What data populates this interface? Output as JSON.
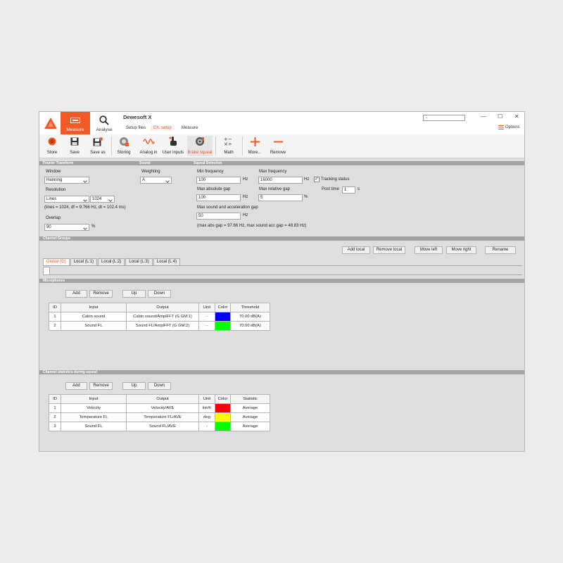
{
  "app": {
    "title": "Dewesoft X",
    "nav": [
      {
        "label": "Measure"
      },
      {
        "label": "Analyse"
      }
    ],
    "subtabs": [
      {
        "label": "Setup files"
      },
      {
        "label": "Ch. setup"
      },
      {
        "label": "Measure"
      }
    ],
    "window_select": {
      "value": "-"
    },
    "window_controls": {
      "minimize": "—",
      "maximize": "☐",
      "close": "✕"
    },
    "options_label": "Options"
  },
  "toolbar": {
    "items": [
      {
        "label": "Store",
        "icon": "record-icon"
      },
      {
        "label": "Save",
        "icon": "floppy-icon"
      },
      {
        "label": "Save as",
        "icon": "floppy-as-icon"
      },
      {
        "label": "Storing",
        "icon": "storing-icon"
      },
      {
        "label": "Analog in",
        "icon": "analog-wave-icon"
      },
      {
        "label": "User inputs",
        "icon": "hand-pointer-icon"
      },
      {
        "label": "Brake squeal",
        "icon": "brake-disc-icon"
      },
      {
        "label": "Math",
        "icon": "math-icon"
      },
      {
        "label": "More...",
        "icon": "plus-icon"
      },
      {
        "label": "Remove",
        "icon": "minus-icon"
      }
    ],
    "accent_color": "#f15a24"
  },
  "fourier": {
    "header": "Fourier Transform",
    "window_label": "Window",
    "window_value": "Hanning",
    "resolution_label": "Resolution",
    "resolution_mode": "Lines",
    "resolution_value": "1024",
    "resolution_info": "(lines = 1024, df = 9.766 Hz, dt = 102.4 ms)",
    "overlap_label": "Overlap",
    "overlap_value": "90",
    "overlap_unit": "%"
  },
  "sound": {
    "header": "Sound",
    "weighting_label": "Weighting",
    "weighting_value": "A"
  },
  "squeal": {
    "header": "Squeal Detection",
    "min_freq_label": "Min frequency",
    "min_freq_value": "100",
    "min_freq_unit": "Hz",
    "max_freq_label": "Max frequency",
    "max_freq_value": "16000",
    "max_freq_unit": "Hz",
    "tracking_label": "Tracking status",
    "tracking_checked": "✓",
    "post_time_label": "Post time",
    "post_time_value": "1",
    "post_time_unit": "s",
    "max_abs_gap_label": "Max absolute gap",
    "max_abs_gap_value": "100",
    "max_abs_gap_unit": "Hz",
    "max_rel_gap_label": "Max relative gap",
    "max_rel_gap_value": "5",
    "max_rel_gap_unit": "%",
    "max_sound_acc_label": "Max sound and acceleration gap",
    "max_sound_acc_value": "50",
    "max_sound_acc_unit": "Hz",
    "info": "(max abs gap = 97.66 Hz, max sound acc gap = 48.83 Hz)"
  },
  "channel_groups": {
    "header": "Channel Groups",
    "buttons": {
      "add_local": "Add local",
      "remove_local": "Remove local",
      "move_left": "Move left",
      "move_right": "Move right",
      "rename": "Rename"
    },
    "tabs": [
      {
        "label": "Global (G)"
      },
      {
        "label": "Local (L:1)"
      },
      {
        "label": "Local (L:2)"
      },
      {
        "label": "Local (L:3)"
      },
      {
        "label": "Local (L:4)"
      }
    ]
  },
  "microphones": {
    "header": "Microphones",
    "buttons": {
      "add": "Add",
      "remove": "Remove",
      "up": "Up",
      "down": "Down"
    },
    "columns": [
      "ID",
      "Input",
      "Output",
      "Unit",
      "Color",
      "Threshold"
    ],
    "rows": [
      {
        "id": "1",
        "input": "Cabin sound",
        "output": "Cabin sound/AmplFFT (G GM:1)",
        "unit": "-",
        "color": "#0000ff",
        "threshold": "70.00 dB(A)"
      },
      {
        "id": "2",
        "input": "Sound FL",
        "output": "Sound FL/AmplFFT (G GM:2)",
        "unit": "-",
        "color": "#00ff00",
        "threshold": "70.00 dB(A)"
      }
    ]
  },
  "statistics": {
    "header": "Channel statistics during squeal",
    "buttons": {
      "add": "Add",
      "remove": "Remove",
      "up": "Up",
      "down": "Down"
    },
    "columns": [
      "ID",
      "Input",
      "Output",
      "Unit",
      "Color",
      "Statistic"
    ],
    "rows": [
      {
        "id": "1",
        "input": "Velocity",
        "output": "Velocity/AVE",
        "unit": "km/h",
        "color": "#ff0000",
        "statistic": "Average"
      },
      {
        "id": "2",
        "input": "Temperature FL",
        "output": "Temperature FL/AVE",
        "unit": "deg",
        "color": "#ffff00",
        "statistic": "Average"
      },
      {
        "id": "3",
        "input": "Sound FL",
        "output": "Sound FL/AVE",
        "unit": "-",
        "color": "#00ff00",
        "statistic": "Average"
      }
    ]
  }
}
